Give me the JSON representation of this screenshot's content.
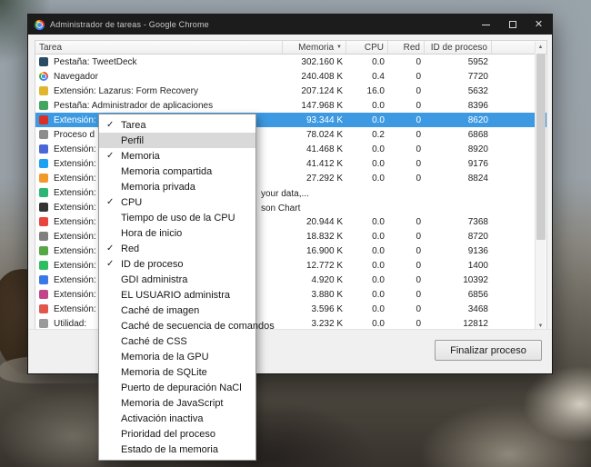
{
  "window": {
    "title": "Administrador de tareas - Google Chrome"
  },
  "icons": {
    "close": "✕",
    "check": "✓",
    "sort_desc": "▼",
    "scroll_up": "▲",
    "scroll_down": "▼"
  },
  "colors": {
    "selection": "#3d9ae2",
    "titlebar": "#1c1c1c",
    "menu_hover": "#d9d9d9"
  },
  "table": {
    "columns": {
      "task": "Tarea",
      "memory": "Memoria",
      "cpu": "CPU",
      "net": "Red",
      "pid": "ID de proceso"
    },
    "sort": {
      "column": "Memoria",
      "direction": "desc"
    },
    "rows": [
      {
        "task": "Pestaña: TweetDeck",
        "memory": "302.160 K",
        "cpu": "0.0",
        "net": "0",
        "pid": "5952",
        "icon": "#2b4a63"
      },
      {
        "task": "Navegador",
        "memory": "240.408 K",
        "cpu": "0.4",
        "net": "0",
        "pid": "7720",
        "icon": "chrome"
      },
      {
        "task": "Extensión: Lazarus: Form Recovery",
        "memory": "207.124 K",
        "cpu": "16.0",
        "net": "0",
        "pid": "5632",
        "icon": "#e0b62f"
      },
      {
        "task": "Pestaña: Administrador de aplicaciones",
        "memory": "147.968 K",
        "cpu": "0.0",
        "net": "0",
        "pid": "8396",
        "icon": "#44a55f"
      },
      {
        "task": "Extensión:",
        "memory": "93.344 K",
        "cpu": "0.0",
        "net": "0",
        "pid": "8620",
        "icon": "#d93025",
        "selected": true
      },
      {
        "task": "Proceso d",
        "memory": "78.024 K",
        "cpu": "0.2",
        "net": "0",
        "pid": "6868",
        "icon": "#8d8d8d"
      },
      {
        "task": "Extensión:",
        "memory": "41.468 K",
        "cpu": "0.0",
        "net": "0",
        "pid": "8920",
        "icon": "#4a67d8"
      },
      {
        "task": "Extensión:",
        "memory": "41.412 K",
        "cpu": "0.0",
        "net": "0",
        "pid": "9176",
        "icon": "#1da1f2"
      },
      {
        "task": "Extensión:",
        "memory": "27.292 K",
        "cpu": "0.0",
        "net": "0",
        "pid": "8824",
        "icon": "#f29a29"
      },
      {
        "task": "Extensión:",
        "task_suffix": "your data,...",
        "memory": "",
        "cpu": "",
        "net": "",
        "pid": "",
        "icon": "#2bb673"
      },
      {
        "task": "Extensión:",
        "task_suffix": "son Chart",
        "memory": "",
        "cpu": "",
        "net": "",
        "pid": "",
        "icon": "#333333"
      },
      {
        "task": "Extensión:",
        "memory": "20.944 K",
        "cpu": "0.0",
        "net": "0",
        "pid": "7368",
        "icon": "#e8453c"
      },
      {
        "task": "Extensión:",
        "memory": "18.832 K",
        "cpu": "0.0",
        "net": "0",
        "pid": "8720",
        "icon": "#7f7f7f"
      },
      {
        "task": "Extensión:",
        "memory": "16.900 K",
        "cpu": "0.0",
        "net": "0",
        "pid": "9136",
        "icon": "#57a747"
      },
      {
        "task": "Extensión:",
        "memory": "12.772 K",
        "cpu": "0.0",
        "net": "0",
        "pid": "1400",
        "icon": "#2dbe60"
      },
      {
        "task": "Extensión:",
        "memory": "4.920 K",
        "cpu": "0.0",
        "net": "0",
        "pid": "10392",
        "icon": "#3b78e7"
      },
      {
        "task": "Extensión:",
        "memory": "3.880 K",
        "cpu": "0.0",
        "net": "0",
        "pid": "6856",
        "icon": "#c2458a"
      },
      {
        "task": "Extensión:",
        "memory": "3.596 K",
        "cpu": "0.0",
        "net": "0",
        "pid": "3468",
        "icon": "#e2574c"
      },
      {
        "task": "Utilidad:",
        "memory": "3.232 K",
        "cpu": "0.0",
        "net": "0",
        "pid": "12812",
        "icon": "#9a9a9a"
      }
    ]
  },
  "context_menu": {
    "items": [
      {
        "label": "Tarea",
        "checked": true
      },
      {
        "label": "Perfil",
        "checked": false,
        "hover": true
      },
      {
        "label": "Memoria",
        "checked": true
      },
      {
        "label": "Memoria compartida",
        "checked": false
      },
      {
        "label": "Memoria privada",
        "checked": false
      },
      {
        "label": "CPU",
        "checked": true
      },
      {
        "label": "Tiempo de uso de la CPU",
        "checked": false
      },
      {
        "label": "Hora de inicio",
        "checked": false
      },
      {
        "label": "Red",
        "checked": true
      },
      {
        "label": "ID de proceso",
        "checked": true
      },
      {
        "label": "GDI administra",
        "checked": false
      },
      {
        "label": "EL USUARIO administra",
        "checked": false
      },
      {
        "label": "Caché de imagen",
        "checked": false
      },
      {
        "label": "Caché de secuencia de comandos",
        "checked": false
      },
      {
        "label": "Caché de CSS",
        "checked": false
      },
      {
        "label": "Memoria de la GPU",
        "checked": false
      },
      {
        "label": "Memoria de SQLite",
        "checked": false
      },
      {
        "label": "Puerto de depuración NaCl",
        "checked": false
      },
      {
        "label": "Memoria de JavaScript",
        "checked": false
      },
      {
        "label": "Activación inactiva",
        "checked": false
      },
      {
        "label": "Prioridad del proceso",
        "checked": false
      },
      {
        "label": "Estado de la memoria",
        "checked": false
      }
    ]
  },
  "footer": {
    "end_process_label": "Finalizar proceso"
  }
}
